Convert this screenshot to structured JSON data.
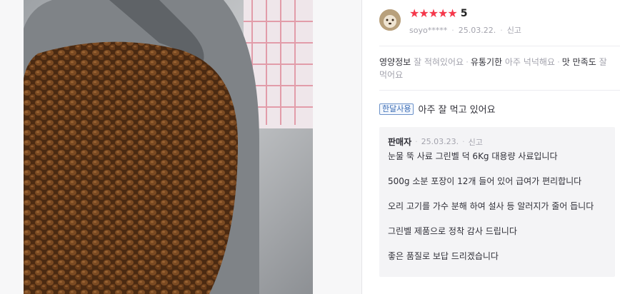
{
  "review": {
    "rating_stars": 5,
    "score": "5",
    "user": "soyo*****",
    "date": "25.03.22.",
    "report": "신고",
    "attributes": [
      {
        "key": "영양정보",
        "value": "잘 적혀있어요"
      },
      {
        "key": "유통기한",
        "value": "아주 넉넉해요"
      },
      {
        "key": "맛 만족도",
        "value": "잘 먹어요"
      }
    ],
    "usage_badge": "한달사용",
    "text": "아주 잘 먹고 있어요"
  },
  "seller_reply": {
    "label": "판매자",
    "date": "25.03.23.",
    "report": "신고",
    "lines": [
      "눈물 뚝 사료 그린벨 덕 6Kg  대용량 사료입니다",
      "500g 소분 포장이 12개 들어 있어 급여가 편리합니다",
      "오리 고기를 가수 분해 하여 설사 등 알러지가 줄어 듭니다",
      "그린벨 제품으로 정착 감사 드립니다",
      "좋은 품질로 보답 드리겠습니다"
    ]
  },
  "colors": {
    "star": "#f5384b",
    "badge": "#3a6cb5",
    "panel": "#f4f4f6"
  },
  "icons": [
    "star-icon",
    "avatar"
  ]
}
